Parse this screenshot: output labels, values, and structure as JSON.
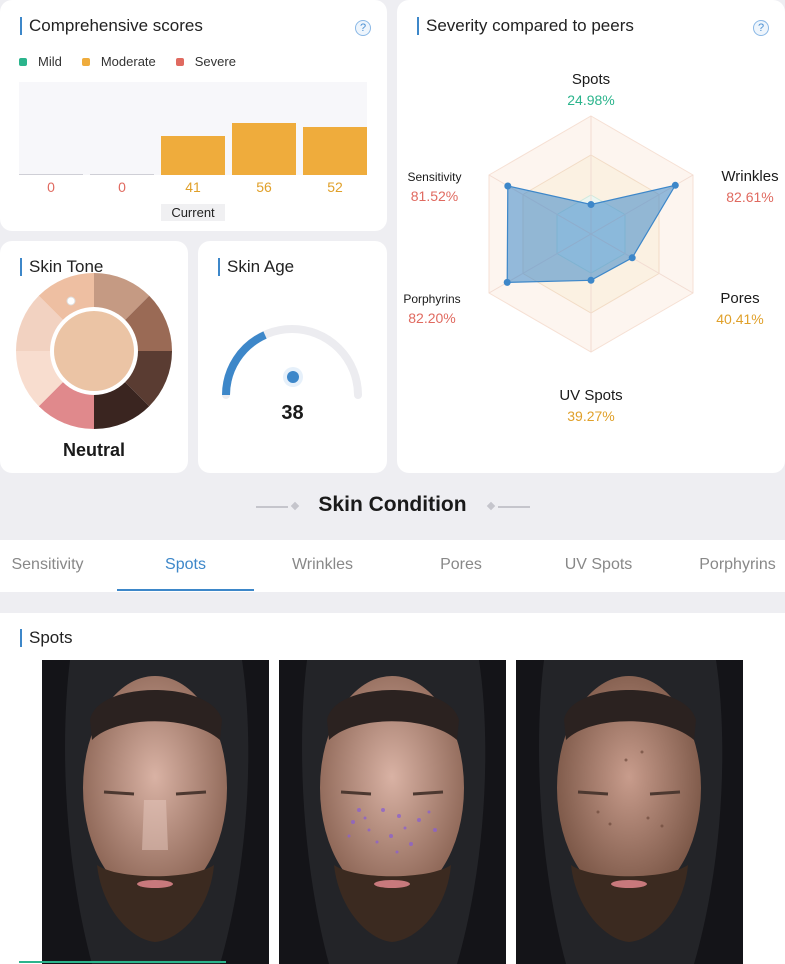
{
  "comprehensive": {
    "title": "Comprehensive scores",
    "help": "?",
    "legend": [
      {
        "label": "Mild",
        "color": "#2bb48c"
      },
      {
        "label": "Moderate",
        "color": "#efac3c"
      },
      {
        "label": "Severe",
        "color": "#e06a60"
      }
    ],
    "bars": [
      {
        "value": "0",
        "color": "#e06a60"
      },
      {
        "value": "0",
        "color": "#e06a60"
      },
      {
        "value": "41",
        "color": "#e0a02a"
      },
      {
        "value": "56",
        "color": "#e0a02a"
      },
      {
        "value": "52",
        "color": "#e0a02a"
      }
    ],
    "current_label": "Current"
  },
  "skin_tone": {
    "title": "Skin Tone",
    "value": "Neutral",
    "swatches": [
      "#c59a83",
      "#9a6a55",
      "#5a3c32",
      "#3a2520",
      "#e0898c",
      "#f8ddcf",
      "#f2d2c1",
      "#eebfa2"
    ],
    "center_color": "#ebc4a5"
  },
  "skin_age": {
    "title": "Skin Age",
    "value": "38"
  },
  "severity": {
    "title": "Severity compared to peers",
    "help": "?",
    "axes": [
      {
        "name": "Spots",
        "pct": "24.98%",
        "color": "#2bb48c"
      },
      {
        "name": "Wrinkles",
        "pct": "82.61%",
        "color": "#e06a60"
      },
      {
        "name": "Pores",
        "pct": "40.41%",
        "color": "#e0a02a"
      },
      {
        "name": "UV Spots",
        "pct": "39.27%",
        "color": "#e0a02a"
      },
      {
        "name": "Porphyrins",
        "pct": "82.20%",
        "color": "#e06a60"
      },
      {
        "name": "Sensitivity",
        "pct": "81.52%",
        "color": "#e06a60"
      }
    ]
  },
  "section": {
    "title": "Skin Condition"
  },
  "tabs": [
    {
      "label": "Sensitivity"
    },
    {
      "label": "Spots"
    },
    {
      "label": "Wrinkles"
    },
    {
      "label": "Pores"
    },
    {
      "label": "UV Spots"
    },
    {
      "label": "Porphyrins"
    }
  ],
  "active_tab": "Spots",
  "spots_panel": {
    "title": "Spots"
  }
}
